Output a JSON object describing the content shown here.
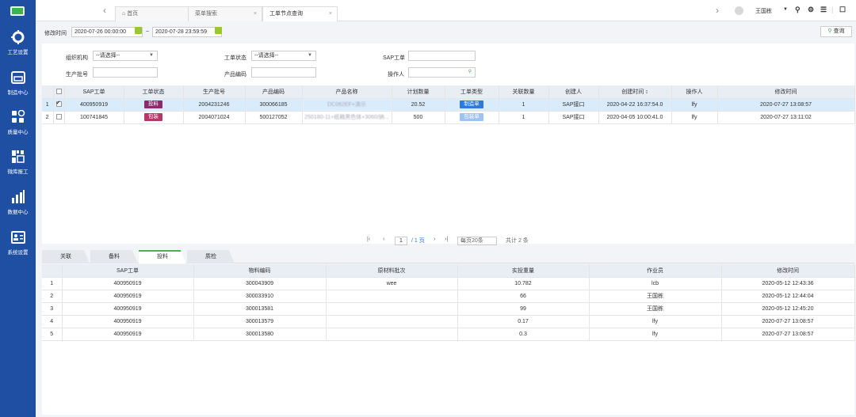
{
  "sidebar": {
    "items": [
      {
        "label": "工艺设置",
        "icon": "gear-icon"
      },
      {
        "label": "制造中心",
        "icon": "folder-icon"
      },
      {
        "label": "质量中心",
        "icon": "quality-grid-icon"
      },
      {
        "label": "微库报工",
        "icon": "warehouse-icon"
      },
      {
        "label": "数据中心",
        "icon": "bar-chart-icon"
      },
      {
        "label": "系统设置",
        "icon": "id-card-icon"
      }
    ]
  },
  "topbar": {
    "tabs": [
      {
        "label": "首页",
        "icon": "home-icon"
      },
      {
        "label": "菜单搜索",
        "close": "×"
      },
      {
        "label": "工单节点查询",
        "close": "×"
      }
    ],
    "user_name": "王国栋",
    "icons": [
      "dropdown-icon",
      "search-icon",
      "gear-icon",
      "menu-icon",
      "window-icon"
    ]
  },
  "filter": {
    "modified_time_label": "修改时间",
    "start_date": "2020-07-26 00:00:00",
    "separator": "~",
    "end_date": "2020-07-28 23:59:59",
    "query_label": "查询"
  },
  "search": {
    "org_label": "组织机构",
    "org_value": "--请选择--",
    "status_label": "工单状态",
    "status_value": "--请选择--",
    "sap_label": "SAP工单",
    "batch_label": "生产批号",
    "product_code_label": "产品编码",
    "operator_label": "操作人"
  },
  "main_table": {
    "headers": [
      "SAP工单",
      "工单状态",
      "生产批号",
      "产品编码",
      "产品名称",
      "计划数量",
      "工单类型",
      "关联数量",
      "创建人",
      "创建时间 ↕",
      "操作人",
      "修改时间"
    ],
    "rows": [
      {
        "idx": "1",
        "sap": "400950919",
        "status": "投料",
        "status_color": "#8b2a6e",
        "batch": "2004231246",
        "product_code": "300066185",
        "product_name": "DC062EF+演示",
        "plan_qty": "20.52",
        "type": "制造单",
        "type_color": "#2f7ad6",
        "link_qty": "1",
        "creator": "SAP接口",
        "created": "2020-04-22 16:37:54.0",
        "operator": "lfy",
        "modified": "2020-07-27 13:08:57",
        "selected": true
      },
      {
        "idx": "2",
        "sap": "100741845",
        "status": "包装",
        "status_color": "#b2396a",
        "batch": "2004071024",
        "product_code": "500127052",
        "product_name": "250180-11+纸箱黑色体+3060/纳...",
        "plan_qty": "500",
        "type": "包装单",
        "type_color": "#9fc3ef",
        "link_qty": "1",
        "creator": "SAP接口",
        "created": "2020-04-05 10:00:41.0",
        "operator": "lfy",
        "modified": "2020-07-27 13:11:02",
        "selected": false
      }
    ]
  },
  "pager": {
    "current_page": "1",
    "total_pages": "/ 1 页",
    "page_size": "每页20条",
    "total": "共计 2 条"
  },
  "bottom_tabs": [
    "关联",
    "备料",
    "投料",
    "质检"
  ],
  "bottom_table": {
    "headers": [
      "SAP工单",
      "物料编码",
      "原材料批次",
      "实投重量",
      "作业员",
      "修改时间"
    ],
    "rows": [
      {
        "idx": "1",
        "sap": "400950919",
        "material": "300043909",
        "batch": "wee",
        "weight": "10.782",
        "worker": "lcb",
        "modified": "2020-05-12 12:43:36"
      },
      {
        "idx": "2",
        "sap": "400950919",
        "material": "300033910",
        "batch": "",
        "weight": "66",
        "worker": "王国栋",
        "modified": "2020-05-12 12:44:04"
      },
      {
        "idx": "3",
        "sap": "400950919",
        "material": "300013581",
        "batch": "",
        "weight": "99",
        "worker": "王国栋",
        "modified": "2020-05-12 12:45:20"
      },
      {
        "idx": "4",
        "sap": "400950919",
        "material": "300013579",
        "batch": "",
        "weight": "0.17",
        "worker": "lfy",
        "modified": "2020-07-27 13:08:57"
      },
      {
        "idx": "5",
        "sap": "400950919",
        "material": "300013580",
        "batch": "",
        "weight": "0.3",
        "worker": "lfy",
        "modified": "2020-07-27 13:08:57"
      }
    ]
  }
}
